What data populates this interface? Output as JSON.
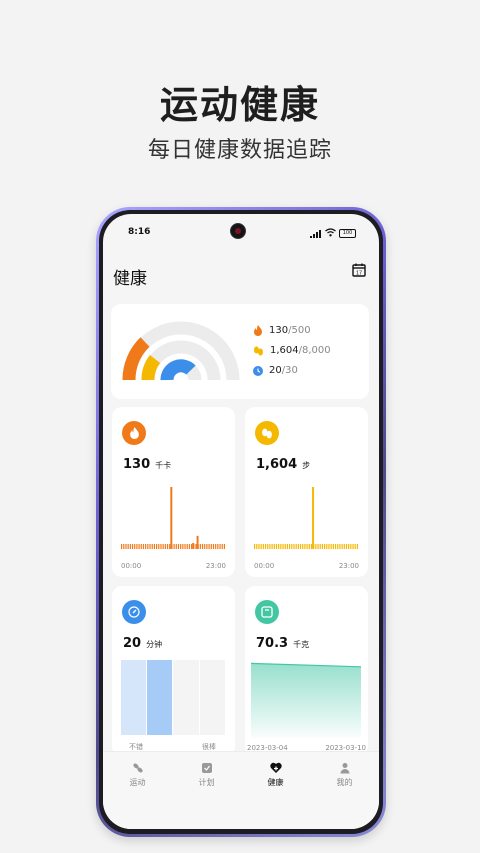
{
  "promo": {
    "headline": "运动健康",
    "subline": "每日健康数据追踪"
  },
  "status_bar": {
    "time": "8:16",
    "battery": "100"
  },
  "app": {
    "title": "健康"
  },
  "summary": {
    "rows": [
      {
        "icon": "flame-icon",
        "value": "130",
        "goal": "/500",
        "color": "#F07A1A"
      },
      {
        "icon": "footprints-icon",
        "value": "1,604",
        "goal": "/8,000",
        "color": "#F5B800"
      },
      {
        "icon": "clock-icon",
        "value": "20",
        "goal": "/30",
        "color": "#3B8EEA"
      }
    ]
  },
  "calories_tile": {
    "icon": "flame-icon",
    "value": "130",
    "unit": "千卡",
    "axis_start": "00:00",
    "axis_end": "23:00",
    "color": "#F07A1A"
  },
  "steps_tile": {
    "icon": "footprints-icon",
    "value": "1,604",
    "unit": "步",
    "axis_start": "00:00",
    "axis_end": "23:00",
    "color": "#F5B800"
  },
  "exercise_tile": {
    "icon": "compass-icon",
    "value": "20",
    "unit": "分钟",
    "label_left": "不错",
    "label_right": "很棒",
    "color": "#3B8EEA"
  },
  "weight_tile": {
    "icon": "scale-icon",
    "value": "70.3",
    "unit": "千克",
    "date_start": "2023-03-04",
    "date_end": "2023-03-10",
    "color": "#43C6A4"
  },
  "chart_data": [
    {
      "type": "bar",
      "title": "",
      "categories": [
        "00:00",
        "01:00",
        "02:00",
        "03:00",
        "04:00",
        "05:00",
        "06:00",
        "07:00",
        "08:00",
        "09:00",
        "10:00",
        "11:00",
        "12:00",
        "13:00",
        "14:00",
        "15:00",
        "16:00",
        "17:00",
        "18:00",
        "19:00",
        "20:00",
        "21:00",
        "22:00",
        "23:00"
      ],
      "values": [
        0,
        0,
        0,
        0,
        0,
        0,
        0,
        0,
        0,
        0,
        0,
        85,
        0,
        0,
        0,
        0,
        6,
        18,
        0,
        0,
        0,
        0,
        0,
        0
      ],
      "unit": "千卡",
      "xlim_labels": [
        "00:00",
        "23:00"
      ]
    },
    {
      "type": "bar",
      "title": "",
      "categories": [
        "00:00",
        "01:00",
        "02:00",
        "03:00",
        "04:00",
        "05:00",
        "06:00",
        "07:00",
        "08:00",
        "09:00",
        "10:00",
        "11:00",
        "12:00",
        "13:00",
        "14:00",
        "15:00",
        "16:00",
        "17:00",
        "18:00",
        "19:00",
        "20:00",
        "21:00",
        "22:00",
        "23:00"
      ],
      "values": [
        0,
        0,
        0,
        0,
        0,
        0,
        0,
        0,
        0,
        0,
        0,
        0,
        0,
        1604,
        0,
        0,
        0,
        0,
        0,
        0,
        0,
        0,
        0,
        0
      ],
      "unit": "步",
      "xlim_labels": [
        "00:00",
        "23:00"
      ]
    },
    {
      "type": "area",
      "title": "",
      "x": [
        "2023-03-04",
        "2023-03-10"
      ],
      "values": [
        70.8,
        70.3
      ],
      "unit": "千克"
    }
  ],
  "nav": {
    "items": [
      {
        "label": "运动",
        "icon": "run-icon"
      },
      {
        "label": "计划",
        "icon": "plan-icon"
      },
      {
        "label": "健康",
        "icon": "heart-icon"
      },
      {
        "label": "我的",
        "icon": "person-icon"
      }
    ],
    "active_index": 2
  }
}
